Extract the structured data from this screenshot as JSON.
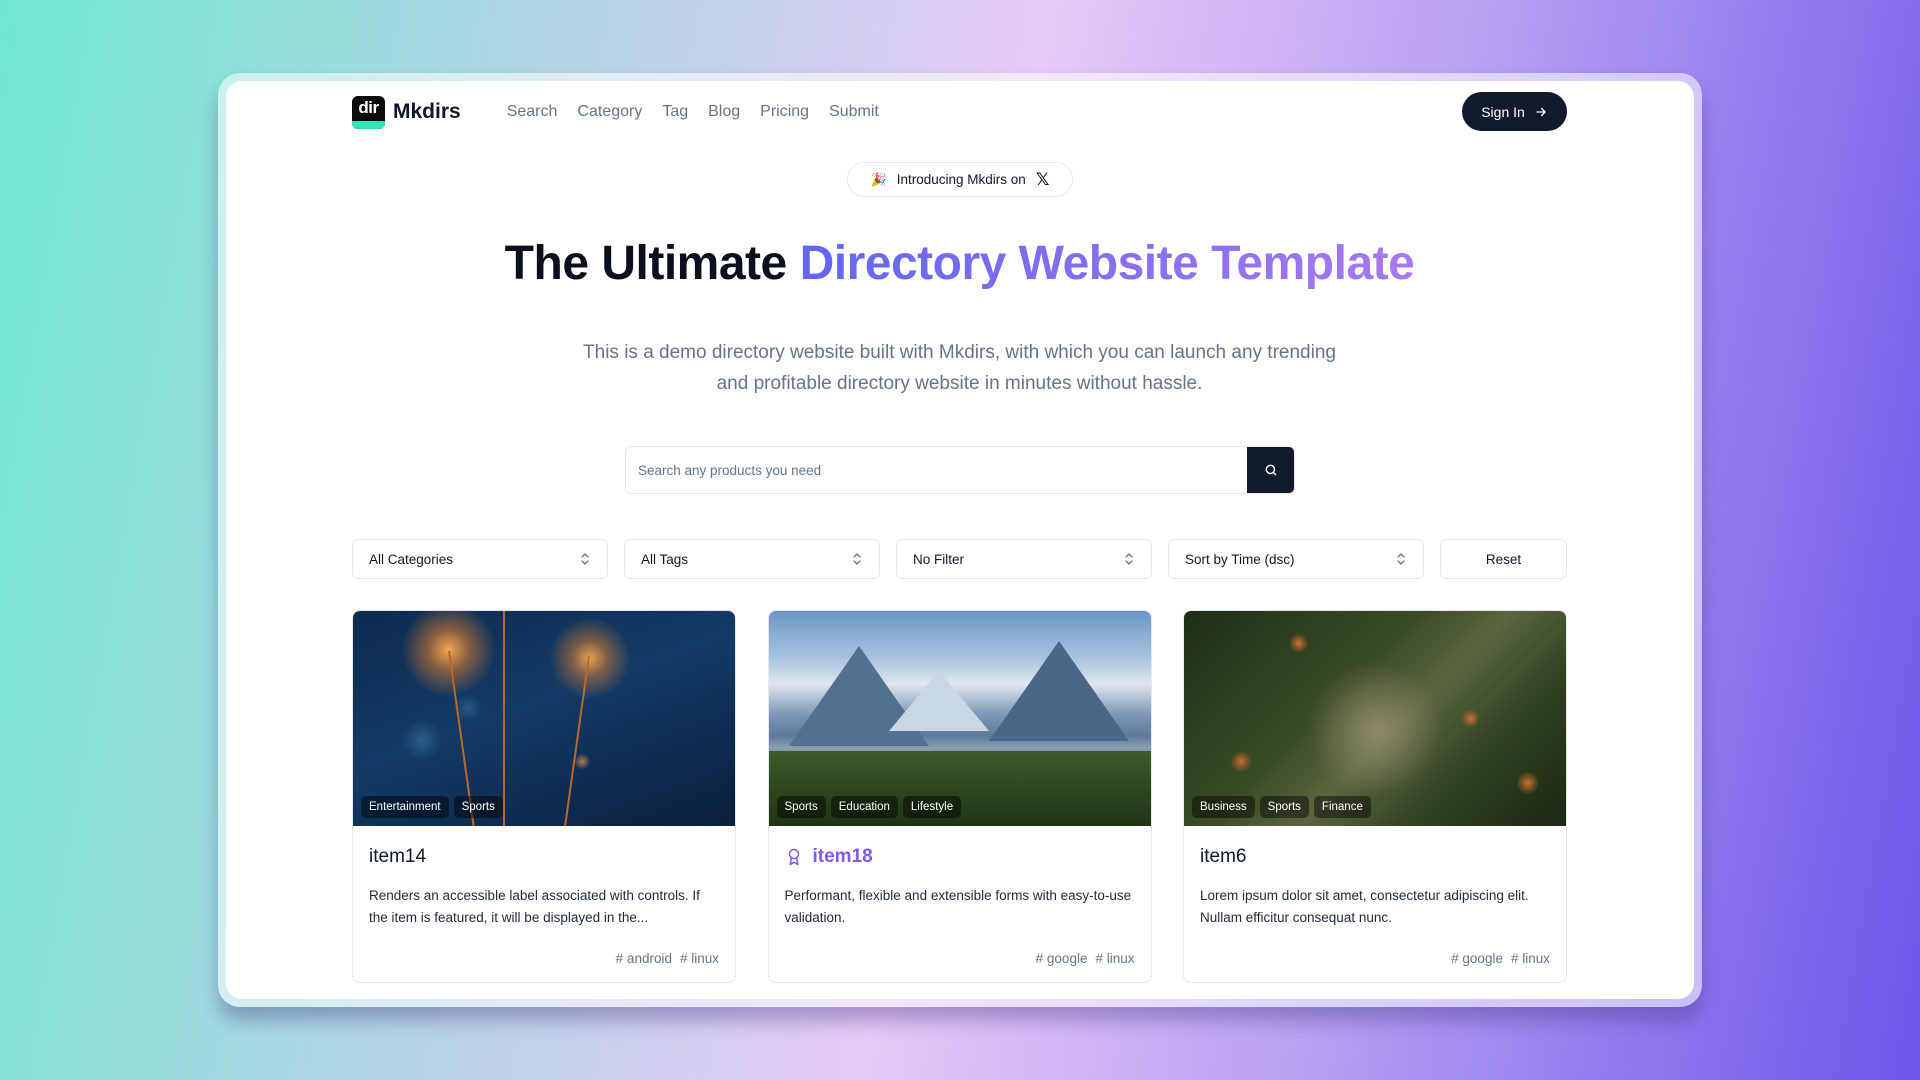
{
  "brand": {
    "logo_text": "dir",
    "name": "Mkdirs"
  },
  "nav": {
    "links": [
      "Search",
      "Category",
      "Tag",
      "Blog",
      "Pricing",
      "Submit"
    ],
    "signin_label": "Sign In"
  },
  "badge": {
    "emoji": "🎉",
    "text": "Introducing Mkdirs on",
    "icon": "x-logo-icon",
    "x_glyph": "𝕏"
  },
  "hero": {
    "title_plain": "The Ultimate ",
    "title_highlight": "Directory Website Template",
    "subtitle": "This is a demo directory website built with Mkdirs, with which you can launch any trending and profitable directory website in minutes without hassle."
  },
  "search": {
    "placeholder": "Search any products you need",
    "value": "",
    "button_icon": "search-icon"
  },
  "filters": {
    "category": "All Categories",
    "tag": "All Tags",
    "filter": "No Filter",
    "sort": "Sort by Time (dsc)",
    "reset_label": "Reset"
  },
  "colors": {
    "primary_dark": "#121a2e",
    "accent_purple": "#7c5cf0",
    "gradient_start": "#6366f1",
    "gradient_end": "#a878f0",
    "muted_text": "#64748b"
  },
  "items": [
    {
      "name": "item14",
      "featured": false,
      "categories": [
        "Entertainment",
        "Sports"
      ],
      "description": "Renders an accessible label associated with controls. If the item is featured, it will be displayed in the...",
      "tags": [
        "# android",
        "# linux"
      ],
      "image": "sparklers"
    },
    {
      "name": "item18",
      "featured": true,
      "categories": [
        "Sports",
        "Education",
        "Lifestyle"
      ],
      "description": "Performant, flexible and extensible forms with easy-to-use validation.",
      "tags": [
        "# google",
        "# linux"
      ],
      "image": "mountains"
    },
    {
      "name": "item6",
      "featured": false,
      "categories": [
        "Business",
        "Sports",
        "Finance"
      ],
      "description": "Lorem ipsum dolor sit amet, consectetur adipiscing elit. Nullam efficitur consequat nunc.",
      "tags": [
        "# google",
        "# linux"
      ],
      "image": "oranges"
    }
  ]
}
